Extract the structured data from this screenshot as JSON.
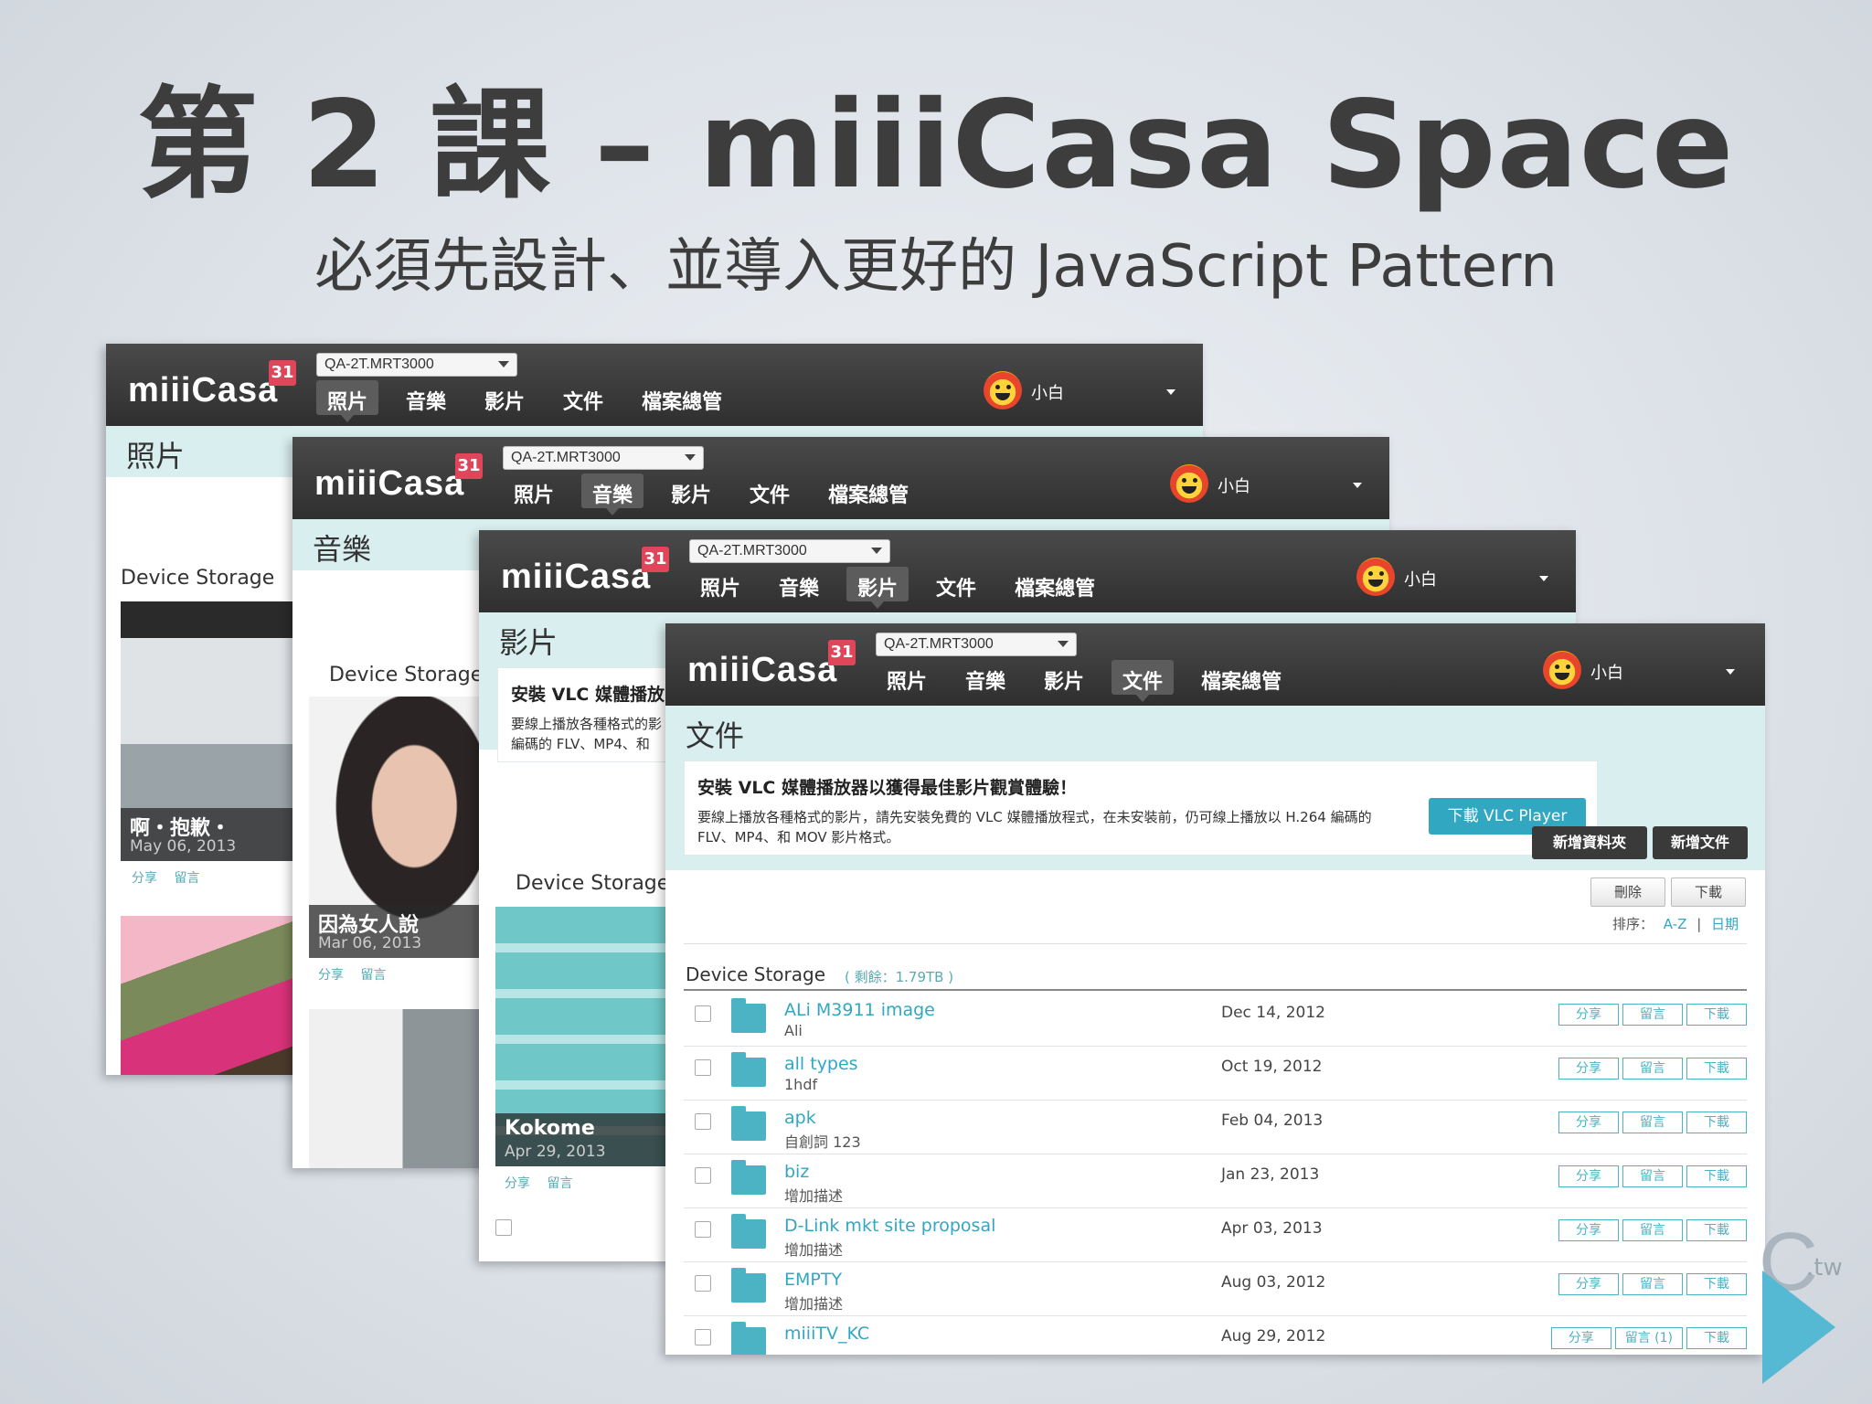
{
  "slide": {
    "title": "第 2 課 – miiiCasa Space",
    "subtitle": "必須先設計、並導入更好的 JavaScript Pattern"
  },
  "app": {
    "logo": "miiiCasa",
    "badge": "31",
    "device": "QA-2T.MRT3000",
    "nav": [
      "照片",
      "音樂",
      "影片",
      "文件",
      "檔案總管"
    ],
    "user": "小白"
  },
  "windows": {
    "photos": {
      "page_title": "照片",
      "storage_label": "Device Storage",
      "item": {
        "title": "啊・抱歉・",
        "date": "May 06, 2013"
      },
      "links": [
        "分享",
        "留言"
      ]
    },
    "music": {
      "page_title": "音樂",
      "storage_label": "Device Storage",
      "item": {
        "title": "因為女人說",
        "date": "Mar 06, 2013"
      },
      "links": [
        "分享",
        "留言"
      ]
    },
    "videos": {
      "page_title": "影片",
      "storage_label": "Device Storage",
      "banner_title": "安裝 VLC 媒體播放",
      "banner_text": "要線上播放各種格式的影 編碼的 FLV、MP4、和",
      "item": {
        "title": "Kokome",
        "date": "Apr 29, 2013"
      },
      "links": [
        "分享",
        "留言"
      ]
    },
    "documents": {
      "page_title": "文件",
      "banner_title": "安裝 VLC 媒體播放器以獲得最佳影片觀賞體驗！",
      "banner_text": "要線上播放各種格式的影片，請先安裝免費的 VLC 媒體播放程式，在未安裝前，仍可線上播放以 H.264 編碼的 FLV、MP4、和 MOV 影片格式。",
      "vlc_button": "下載 VLC Player",
      "new_folder": "新增資料夾",
      "new_file": "新增文件",
      "delete": "刪除",
      "download": "下載",
      "sort_label": "排序：",
      "sort_az": "A-Z",
      "sort_date": "日期",
      "storage_label": "Device Storage",
      "storage_free": "( 剩餘：1.79TB )",
      "row_actions": [
        "分享",
        "留言",
        "下載"
      ],
      "files": [
        {
          "name": "ALi M3911 image",
          "desc": "Ali",
          "date": "Dec 14, 2012",
          "comment": "留言"
        },
        {
          "name": "all types",
          "desc": "1hdf",
          "date": "Oct 19, 2012",
          "comment": "留言"
        },
        {
          "name": "apk",
          "desc": "自創詞 123",
          "date": "Feb 04, 2013",
          "comment": "留言"
        },
        {
          "name": "biz",
          "desc": "增加描述",
          "date": "Jan 23, 2013",
          "comment": "留言"
        },
        {
          "name": "D-Link mkt site proposal",
          "desc": "增加描述",
          "date": "Apr 03, 2013",
          "comment": "留言"
        },
        {
          "name": "EMPTY",
          "desc": "增加描述",
          "date": "Aug 03, 2012",
          "comment": "留言"
        },
        {
          "name": "miiiTV_KC",
          "desc": "",
          "date": "Aug 29, 2012",
          "comment": "留言 (1)"
        }
      ]
    }
  },
  "corner": {
    "mark": "C",
    "suffix": ".tw"
  },
  "colors": {
    "accent": "#32a7c2",
    "topbar": "#333333",
    "page_head": "#d9eeee",
    "badge": "#e0455a"
  }
}
